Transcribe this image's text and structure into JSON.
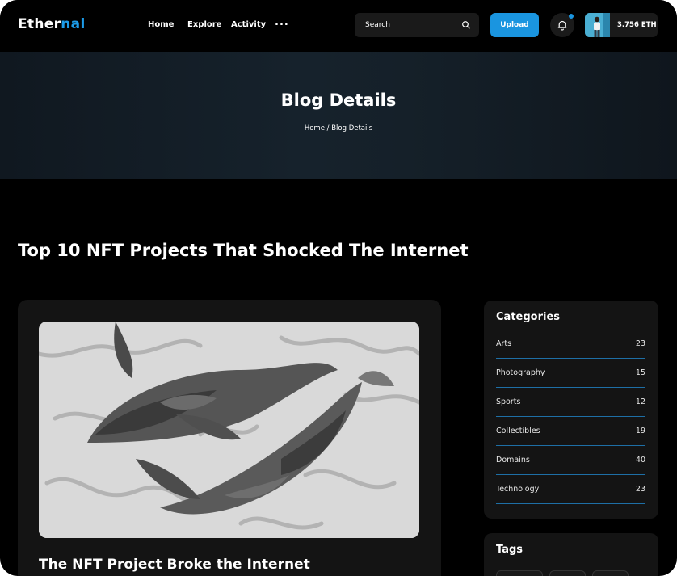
{
  "header": {
    "logo_part1": "Ether",
    "logo_part2": "nal",
    "nav": [
      "Home",
      "Explore",
      "Activity",
      "..."
    ],
    "search_placeholder": "Search",
    "upload_label": "Upload",
    "balance": "3.756 ETH",
    "accent_color": "#1a95e0"
  },
  "banner": {
    "title": "Blog Details",
    "breadcrumb": "Home / Blog Details"
  },
  "post": {
    "title": "Top 10 NFT Projects That Shocked The Internet",
    "card_heading": "The NFT Project Broke the Internet"
  },
  "sidebar": {
    "categories_heading": "Categories",
    "categories": [
      {
        "name": "Arts",
        "count": "23"
      },
      {
        "name": "Photography",
        "count": "15"
      },
      {
        "name": "Sports",
        "count": "12"
      },
      {
        "name": "Collectibles",
        "count": "19"
      },
      {
        "name": "Domains",
        "count": "40"
      },
      {
        "name": "Technology",
        "count": "23"
      }
    ],
    "tags_heading": "Tags"
  }
}
